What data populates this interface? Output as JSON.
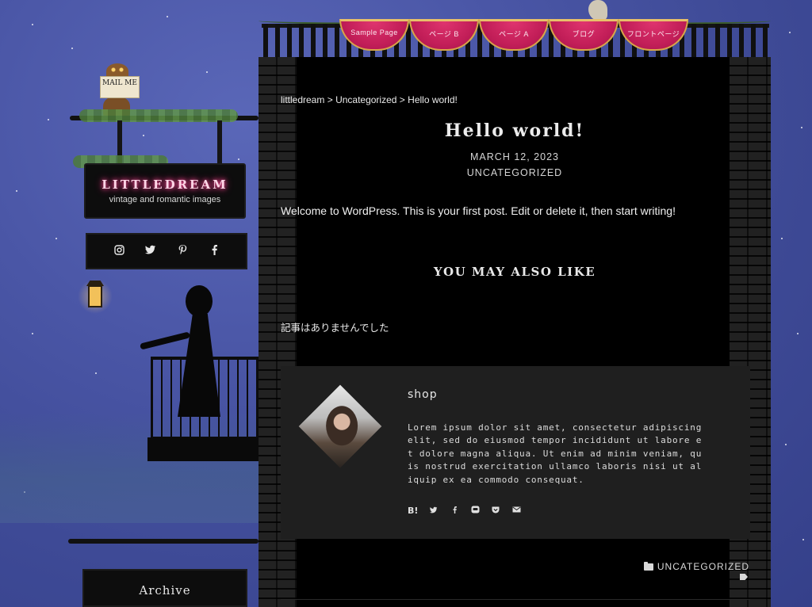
{
  "sidebar": {
    "mail_label": "MAIL ME",
    "site_title": "LITTLEDREAM",
    "tagline": "vintage and romantic images",
    "social_icons": [
      "instagram-icon",
      "twitter-icon",
      "pinterest-icon",
      "facebook-icon"
    ],
    "archive_title": "Archive"
  },
  "menu": {
    "items": [
      "Sample Page",
      "ページ B",
      "ページ A",
      "ブログ",
      "フロントページ"
    ]
  },
  "breadcrumb": {
    "items": [
      "littledream",
      "Uncategorized",
      "Hello world!"
    ],
    "separator": ">"
  },
  "post": {
    "title": "Hello world!",
    "date": "MARCH 12, 2023",
    "category": "UNCATEGORIZED",
    "body": "Welcome to WordPress. This is your first post. Edit or delete it, then start writing!",
    "related_heading": "YOU MAY ALSO LIKE",
    "related_empty": "記事はありませんでした",
    "footer_category": "UNCATEGORIZED"
  },
  "author": {
    "name": "shop",
    "description": "Lorem ipsum dolor sit amet, consectetur adipiscing elit, sed do eiusmod tempor incididunt ut labore et dolore magna aliqua. Ut enim ad minim veniam, quis nostrud exercitation ullamco laboris nisi ut aliquip ex ea commodo consequat.",
    "share_icons": [
      "hatena-bookmark-icon",
      "twitter-icon",
      "facebook-icon",
      "line-icon",
      "pocket-icon",
      "mail-icon"
    ]
  },
  "colors": {
    "accent_pink": "#c21e58",
    "gold_trim": "#d8a648",
    "title_glow": "#ff2d86",
    "panel_bg": "#000000",
    "author_box_bg": "#1f1f1f"
  }
}
